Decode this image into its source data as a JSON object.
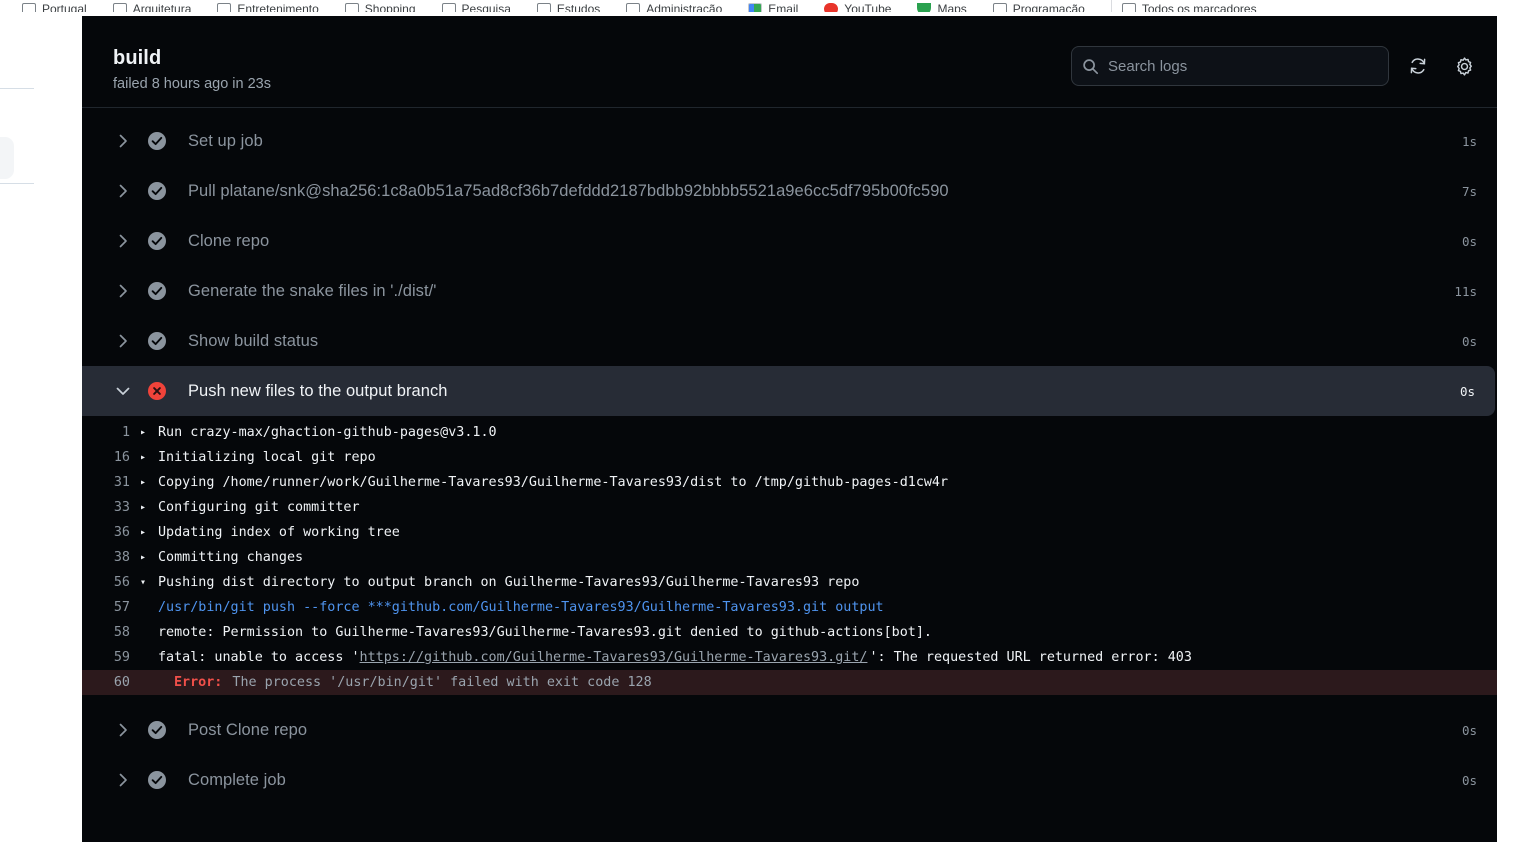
{
  "browser": {
    "bookmarks": [
      {
        "label": "Portugal",
        "icon": "folder-icon"
      },
      {
        "label": "Arquitetura",
        "icon": "folder-icon"
      },
      {
        "label": "Entretenimento",
        "icon": "folder-icon"
      },
      {
        "label": "Shopping",
        "icon": "folder-icon"
      },
      {
        "label": "Pesquisa",
        "icon": "folder-icon"
      },
      {
        "label": "Estudos",
        "icon": "folder-icon"
      },
      {
        "label": "Administração",
        "icon": "folder-icon"
      },
      {
        "label": "Email",
        "icon": "gmail-icon"
      },
      {
        "label": "YouTube",
        "icon": "youtube-icon"
      },
      {
        "label": "Maps",
        "icon": "maps-icon"
      },
      {
        "label": "Programação",
        "icon": "folder-icon"
      },
      {
        "label": "Todos os marcadores",
        "icon": "folder-icon"
      }
    ]
  },
  "header": {
    "title": "build",
    "subtitle": "failed 8 hours ago in 23s",
    "search_placeholder": "Search logs",
    "search_value": "",
    "search_icon": "search-icon",
    "refresh_icon": "refresh-icon",
    "settings_icon": "gear-icon"
  },
  "steps": [
    {
      "label": "Set up job",
      "status": "success",
      "duration": "1s",
      "expanded": false
    },
    {
      "label": "Pull platane/snk@sha256:1c8a0b51a75ad8cf36b7defddd2187bdbb92bbbb5521a9e6cc5df795b00fc590",
      "status": "success",
      "duration": "7s",
      "expanded": false
    },
    {
      "label": "Clone repo",
      "status": "success",
      "duration": "0s",
      "expanded": false
    },
    {
      "label": "Generate the snake files in './dist/'",
      "status": "success",
      "duration": "11s",
      "expanded": false
    },
    {
      "label": "Show build status",
      "status": "success",
      "duration": "0s",
      "expanded": false
    },
    {
      "label": "Push new files to the output branch",
      "status": "failure",
      "duration": "0s",
      "expanded": true
    },
    {
      "label": "Post Clone repo",
      "status": "success",
      "duration": "0s",
      "expanded": false
    },
    {
      "label": "Complete job",
      "status": "success",
      "duration": "0s",
      "expanded": false
    }
  ],
  "log": [
    {
      "line": "1",
      "marker": "collapsed",
      "text": "Run crazy-max/ghaction-github-pages@v3.1.0"
    },
    {
      "line": "16",
      "marker": "collapsed",
      "text": "Initializing local git repo"
    },
    {
      "line": "31",
      "marker": "collapsed",
      "text": "Copying /home/runner/work/Guilherme-Tavares93/Guilherme-Tavares93/dist to /tmp/github-pages-d1cw4r"
    },
    {
      "line": "33",
      "marker": "collapsed",
      "text": "Configuring git committer"
    },
    {
      "line": "36",
      "marker": "collapsed",
      "text": "Updating index of working tree"
    },
    {
      "line": "38",
      "marker": "collapsed",
      "text": "Committing changes"
    },
    {
      "line": "56",
      "marker": "expanded",
      "text": "Pushing dist directory to output branch on Guilherme-Tavares93/Guilherme-Tavares93 repo"
    },
    {
      "line": "57",
      "marker": "none",
      "style": "blue",
      "text": "/usr/bin/git push --force ***github.com/Guilherme-Tavares93/Guilherme-Tavares93.git output"
    },
    {
      "line": "58",
      "marker": "none",
      "text": "remote: Permission to Guilherme-Tavares93/Guilherme-Tavares93.git denied to github-actions[bot]."
    },
    {
      "line": "59",
      "marker": "none",
      "text_before": "fatal: unable to access '",
      "link": "https://github.com/Guilherme-Tavares93/Guilherme-Tavares93.git/",
      "text_after": "': The requested URL returned error: 403"
    },
    {
      "line": "60",
      "marker": "none",
      "style": "error",
      "error_tag": "Error:",
      "text": " The process '/usr/bin/git' failed with exit code 128"
    }
  ],
  "colors": {
    "panel_bg": "#05070a",
    "highlight_row": "#272c36",
    "error_row": "#2c191c",
    "error_red": "#f1504a",
    "status_fail": "#f0433a",
    "status_ok": "#8b949e",
    "link_blue": "#4f94ef",
    "muted_text": "#8b949e"
  }
}
